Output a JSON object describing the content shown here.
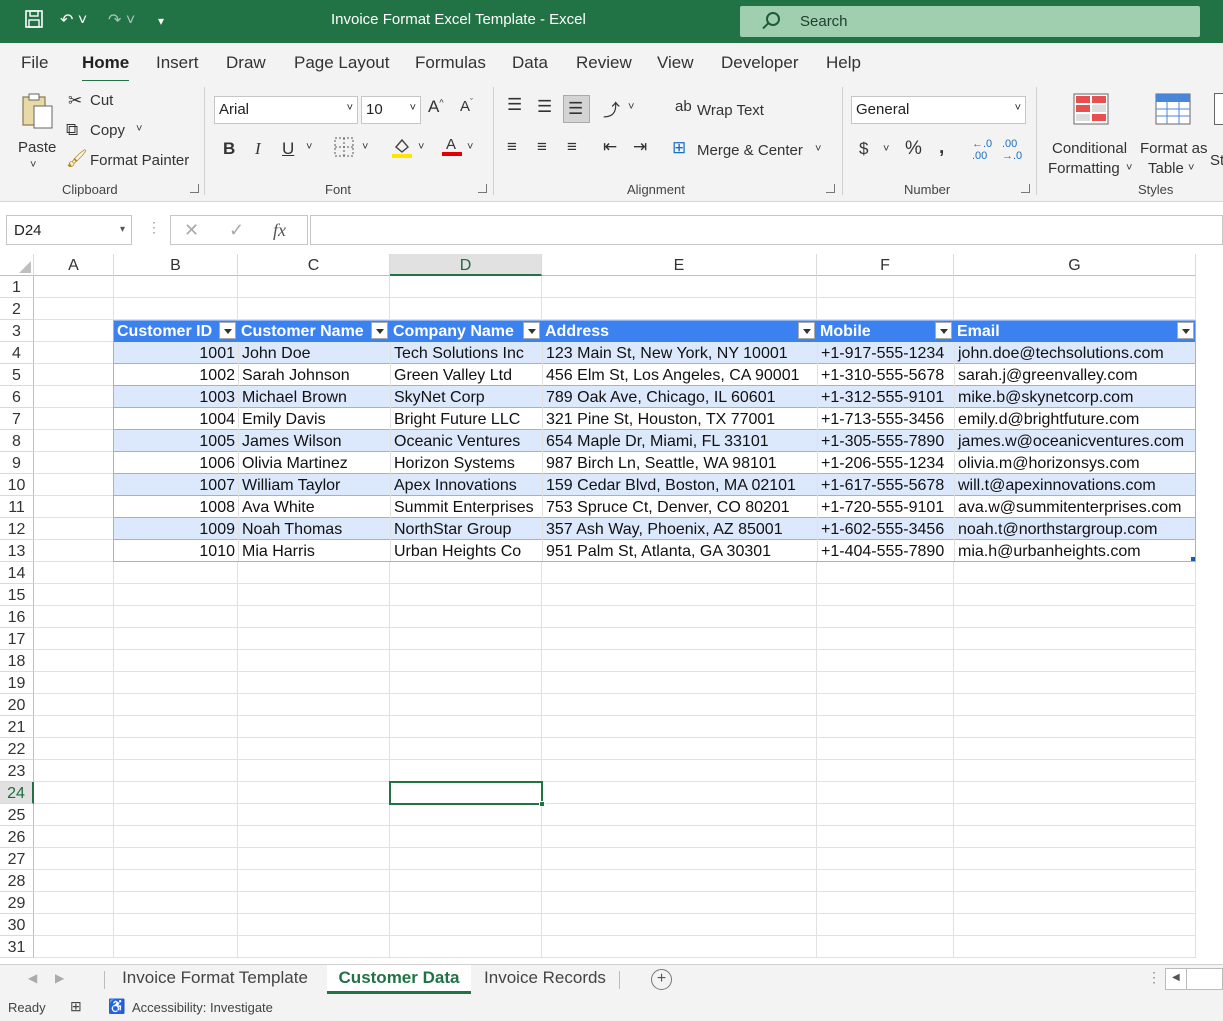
{
  "window": {
    "title": "Invoice Format Excel Template  -  Excel",
    "search_placeholder": "Search"
  },
  "menu": [
    "File",
    "Home",
    "Insert",
    "Draw",
    "Page Layout",
    "Formulas",
    "Data",
    "Review",
    "View",
    "Developer",
    "Help"
  ],
  "ribbon": {
    "clipboard": {
      "paste": "Paste",
      "cut": "Cut",
      "copy": "Copy",
      "format_painter": "Format Painter",
      "label": "Clipboard"
    },
    "font": {
      "font_name": "Arial",
      "font_size": "10",
      "label": "Font"
    },
    "alignment": {
      "wrap_text": "Wrap Text",
      "merge_center": "Merge & Center",
      "label": "Alignment"
    },
    "number": {
      "format": "General",
      "label": "Number"
    },
    "styles": {
      "conditional_formatting_1": "Conditional",
      "conditional_formatting_2": "Formatting",
      "format_as_table_1": "Format as",
      "format_as_table_2": "Table",
      "cell_styles_partial": "St",
      "label": "Styles"
    },
    "colors": {
      "fill": "#ffe600",
      "font": "#e00000"
    }
  },
  "formula_bar": {
    "name_box": "D24",
    "fx": "fx",
    "value": ""
  },
  "columns": [
    "A",
    "B",
    "C",
    "D",
    "E",
    "F",
    "G"
  ],
  "selected_column": "D",
  "rows": [
    "1",
    "2",
    "3",
    "4",
    "5",
    "6",
    "7",
    "8",
    "9",
    "10",
    "11",
    "12",
    "13",
    "14",
    "15",
    "16",
    "17",
    "18",
    "19",
    "20",
    "21",
    "22",
    "23",
    "24",
    "25",
    "26",
    "27",
    "28",
    "29",
    "30",
    "31"
  ],
  "selected_row": "24",
  "table": {
    "headers": [
      "Customer ID",
      "Customer Name",
      "Company Name",
      "Address",
      "Mobile",
      "Email"
    ],
    "rows": [
      [
        "1001",
        "John Doe",
        "Tech Solutions Inc",
        "123 Main St, New York, NY 10001",
        "+1-917-555-1234",
        "john.doe@techsolutions.com"
      ],
      [
        "1002",
        "Sarah Johnson",
        "Green Valley Ltd",
        "456 Elm St, Los Angeles, CA 90001",
        "+1-310-555-5678",
        "sarah.j@greenvalley.com"
      ],
      [
        "1003",
        "Michael Brown",
        "SkyNet Corp",
        "789 Oak Ave, Chicago, IL 60601",
        "+1-312-555-9101",
        "mike.b@skynetcorp.com"
      ],
      [
        "1004",
        "Emily Davis",
        "Bright Future LLC",
        "321 Pine St, Houston, TX 77001",
        "+1-713-555-3456",
        "emily.d@brightfuture.com"
      ],
      [
        "1005",
        "James Wilson",
        "Oceanic Ventures",
        "654 Maple Dr, Miami, FL 33101",
        "+1-305-555-7890",
        "james.w@oceanicventures.com"
      ],
      [
        "1006",
        "Olivia Martinez",
        "Horizon Systems",
        "987 Birch Ln, Seattle, WA 98101",
        "+1-206-555-1234",
        "olivia.m@horizonsys.com"
      ],
      [
        "1007",
        "William Taylor",
        "Apex Innovations",
        "159 Cedar Blvd, Boston, MA 02101",
        "+1-617-555-5678",
        "will.t@apexinnovations.com"
      ],
      [
        "1008",
        "Ava White",
        "Summit Enterprises",
        "753 Spruce Ct, Denver, CO 80201",
        "+1-720-555-9101",
        "ava.w@summitenterprises.com"
      ],
      [
        "1009",
        "Noah Thomas",
        "NorthStar Group",
        "357 Ash Way, Phoenix, AZ 85001",
        "+1-602-555-3456",
        "noah.t@northstargroup.com"
      ],
      [
        "1010",
        "Mia Harris",
        "Urban Heights Co",
        "951 Palm St, Atlanta, GA 30301",
        "+1-404-555-7890",
        "mia.h@urbanheights.com"
      ]
    ],
    "colors": {
      "header_bg": "#3b82f0",
      "band_bg": "#dce8fc",
      "border": "#8eb4f5"
    }
  },
  "sheets": [
    "Invoice Format Template",
    "Customer Data",
    "Invoice Records"
  ],
  "active_sheet": "Customer Data",
  "status": {
    "ready": "Ready",
    "accessibility": "Accessibility: Investigate"
  }
}
